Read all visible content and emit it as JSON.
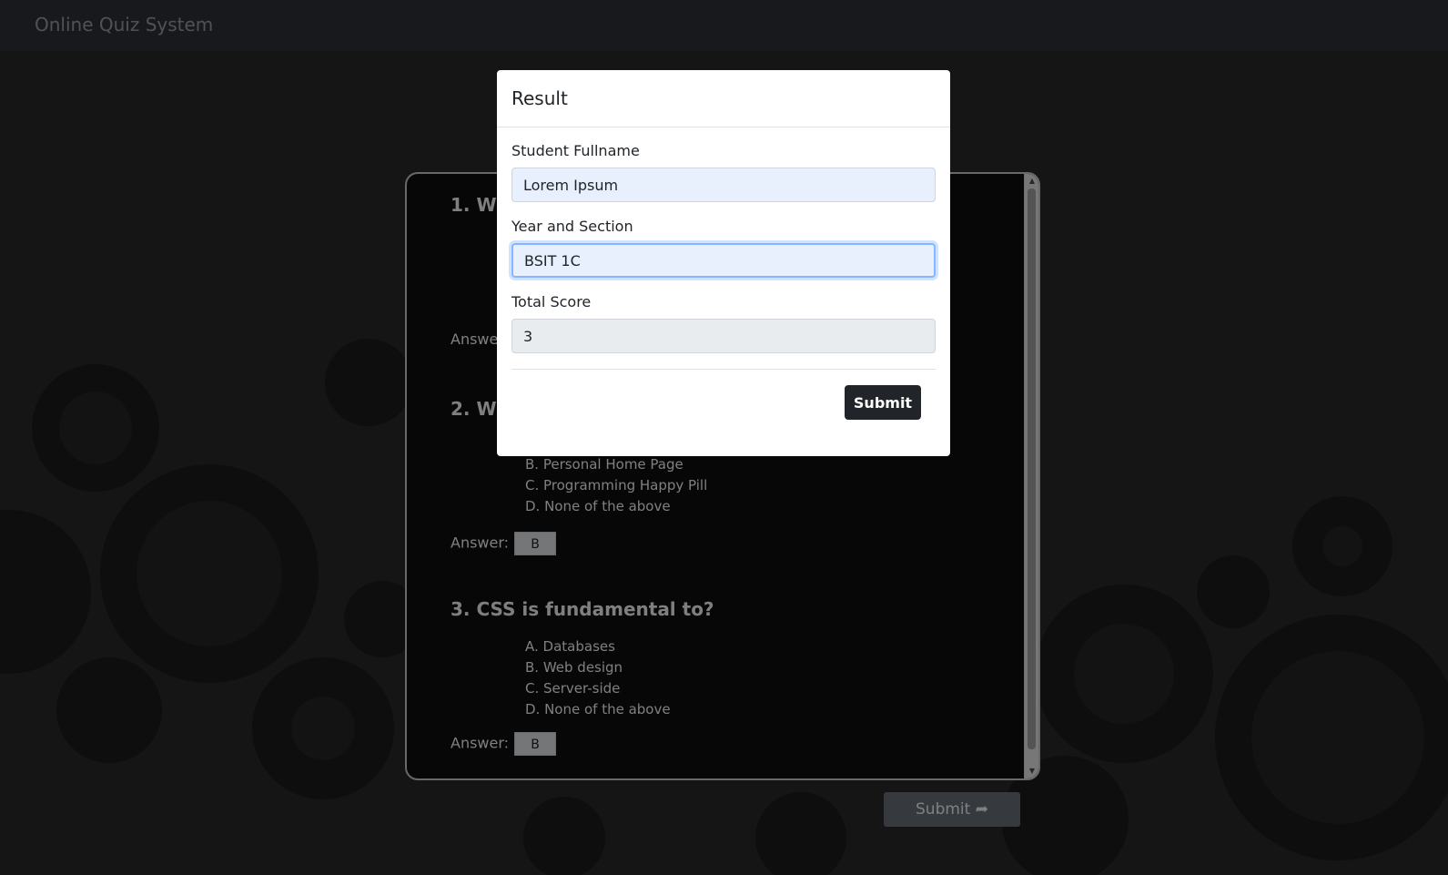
{
  "navbar": {
    "brand": "Online Quiz System"
  },
  "quiz": {
    "questions": [
      {
        "title": "1. Wh",
        "options": [],
        "answer": ""
      },
      {
        "title": "2. Wh",
        "options": [
          "B. Personal Home Page",
          "C. Programming Happy Pill",
          "D. None of the above"
        ],
        "answer": "B"
      },
      {
        "title": "3. CSS is fundamental to?",
        "options": [
          "A. Databases",
          "B. Web design",
          "C. Server-side",
          "D. None of the above"
        ],
        "answer": "B"
      }
    ],
    "answer_label": "Answe",
    "answer_label_full": "Answer:",
    "submit_label": "Submit ➦"
  },
  "modal": {
    "title": "Result",
    "fields": {
      "fullname": {
        "label": "Student Fullname",
        "value": "Lorem Ipsum"
      },
      "section": {
        "label": "Year and Section",
        "value": "BSIT 1C"
      },
      "score": {
        "label": "Total Score",
        "value": "3"
      }
    },
    "submit_label": "Submit"
  }
}
